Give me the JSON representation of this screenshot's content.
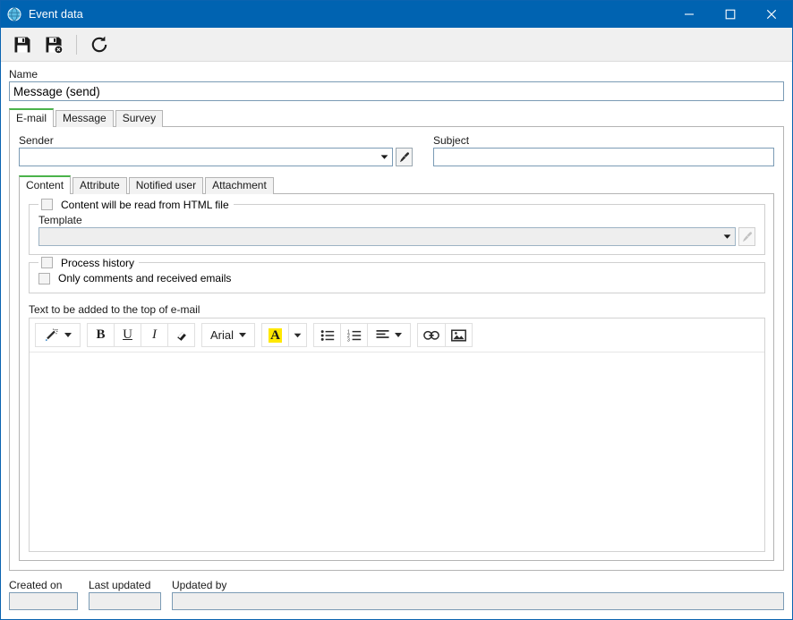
{
  "window": {
    "title": "Event data",
    "app_icon": "globe-icon",
    "minimize_label": "Minimize",
    "maximize_label": "Maximize",
    "close_label": "Close",
    "accent_color": "#0063b1"
  },
  "toolbar": {
    "buttons": [
      {
        "name": "save-button",
        "icon": "save-icon",
        "label": "Save"
      },
      {
        "name": "save-and-close-button",
        "icon": "save-close-icon",
        "label": "Save and close"
      },
      {
        "name": "refresh-button",
        "icon": "refresh-icon",
        "label": "Refresh"
      }
    ]
  },
  "name_field": {
    "label": "Name",
    "value": "Message (send)",
    "placeholder": ""
  },
  "outer_tabs": {
    "active": "E-mail",
    "items": [
      {
        "label": "E-mail"
      },
      {
        "label": "Message"
      },
      {
        "label": "Survey"
      }
    ]
  },
  "sender": {
    "label": "Sender",
    "value": "",
    "placeholder": "",
    "picker_icon": "brush-icon",
    "picker_enabled": true
  },
  "subject": {
    "label": "Subject",
    "value": "",
    "placeholder": ""
  },
  "inner_tabs": {
    "active": "Content",
    "items": [
      {
        "label": "Content"
      },
      {
        "label": "Attribute"
      },
      {
        "label": "Notified user"
      },
      {
        "label": "Attachment"
      }
    ]
  },
  "html_group": {
    "legend": "Content will be read from HTML file",
    "checked": false,
    "template": {
      "label": "Template",
      "value": "",
      "placeholder": "",
      "enabled": false,
      "picker_icon": "brush-icon",
      "picker_enabled": false
    }
  },
  "process_history_group": {
    "legend": "Process history",
    "checked": false,
    "option": {
      "label": "Only comments and received emails",
      "checked": false
    }
  },
  "editor": {
    "label": "Text to be added to the top of e-mail",
    "content": "",
    "toolbar": [
      {
        "name": "style-wand-button",
        "icon": "magic-wand-icon",
        "label": "",
        "has_caret": true
      },
      {
        "name": "bold-button",
        "icon": "bold-icon",
        "label": "B"
      },
      {
        "name": "underline-button",
        "icon": "underline-icon",
        "label": "U"
      },
      {
        "name": "italic-button",
        "icon": "italic-icon",
        "label": "I"
      },
      {
        "name": "clear-format-button",
        "icon": "eraser-icon",
        "label": ""
      },
      {
        "name": "font-family-select",
        "icon": "font-icon",
        "label": "Arial",
        "has_caret": true
      },
      {
        "name": "highlight-color-button",
        "icon": "highlight-color-icon",
        "label": "A"
      },
      {
        "name": "highlight-color-dropdown",
        "icon": "chevron-down-icon",
        "label": ""
      },
      {
        "name": "bullet-list-button",
        "icon": "bullet-list-icon",
        "label": ""
      },
      {
        "name": "numbered-list-button",
        "icon": "numbered-list-icon",
        "label": ""
      },
      {
        "name": "align-button",
        "icon": "align-icon",
        "label": "",
        "has_caret": true
      },
      {
        "name": "insert-link-button",
        "icon": "link-icon",
        "label": ""
      },
      {
        "name": "insert-image-button",
        "icon": "image-icon",
        "label": ""
      }
    ],
    "highlight_color": "#ffe800"
  },
  "footer": {
    "created_on": {
      "label": "Created on",
      "value": "",
      "enabled": false
    },
    "last_updated": {
      "label": "Last updated",
      "value": "",
      "enabled": false
    },
    "updated_by": {
      "label": "Updated by",
      "value": "",
      "enabled": false
    }
  }
}
